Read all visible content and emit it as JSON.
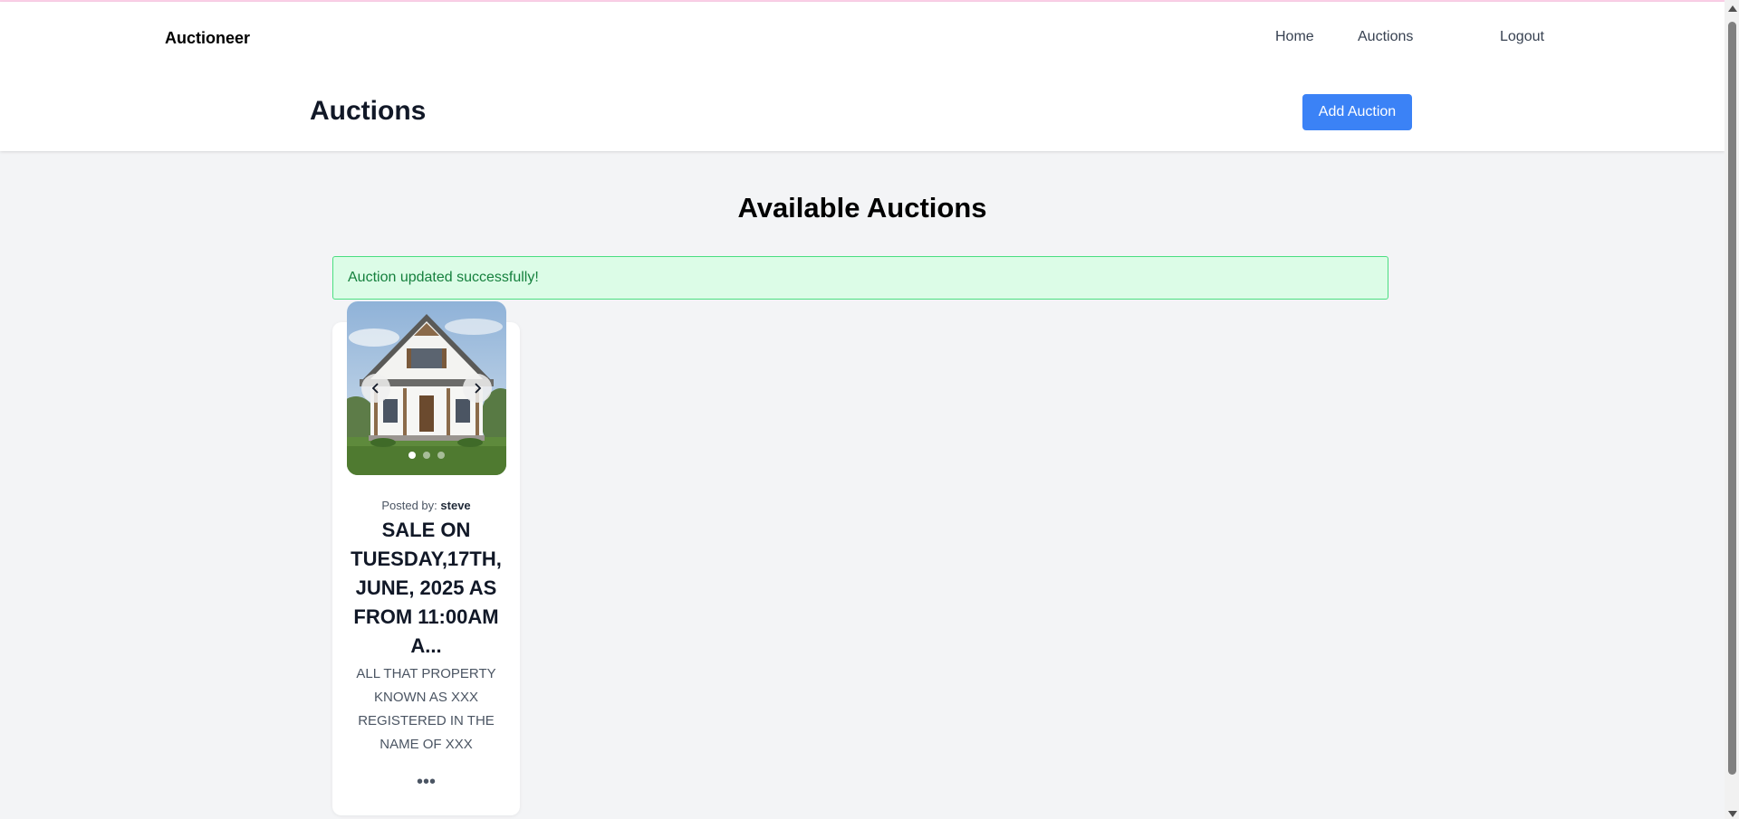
{
  "colors": {
    "accent": "#3b82f6",
    "alert_bg": "#dcfce7",
    "alert_border": "#4ade80",
    "alert_text": "#15803d",
    "page_bg": "#f3f4f6"
  },
  "nav": {
    "brand": "Auctioneer",
    "links": [
      "Home",
      "Auctions",
      "Logout"
    ]
  },
  "header": {
    "title": "Auctions",
    "add_button": "Add Auction"
  },
  "main": {
    "section_title": "Available Auctions",
    "alert": "Auction updated successfully!"
  },
  "auction": {
    "posted_by_label": "Posted by:",
    "posted_by_user": "steve",
    "title": "SALE ON TUESDAY,17TH, JUNE, 2025 AS FROM 11:00AM A...",
    "description": "ALL THAT PROPERTY KNOWN AS XXX REGISTERED IN THE NAME OF XXX",
    "more": "•••",
    "image_alt": "house-photo",
    "slides": 3,
    "active_slide": 1,
    "prev_icon": "chevron-left-icon",
    "next_icon": "chevron-right-icon"
  }
}
